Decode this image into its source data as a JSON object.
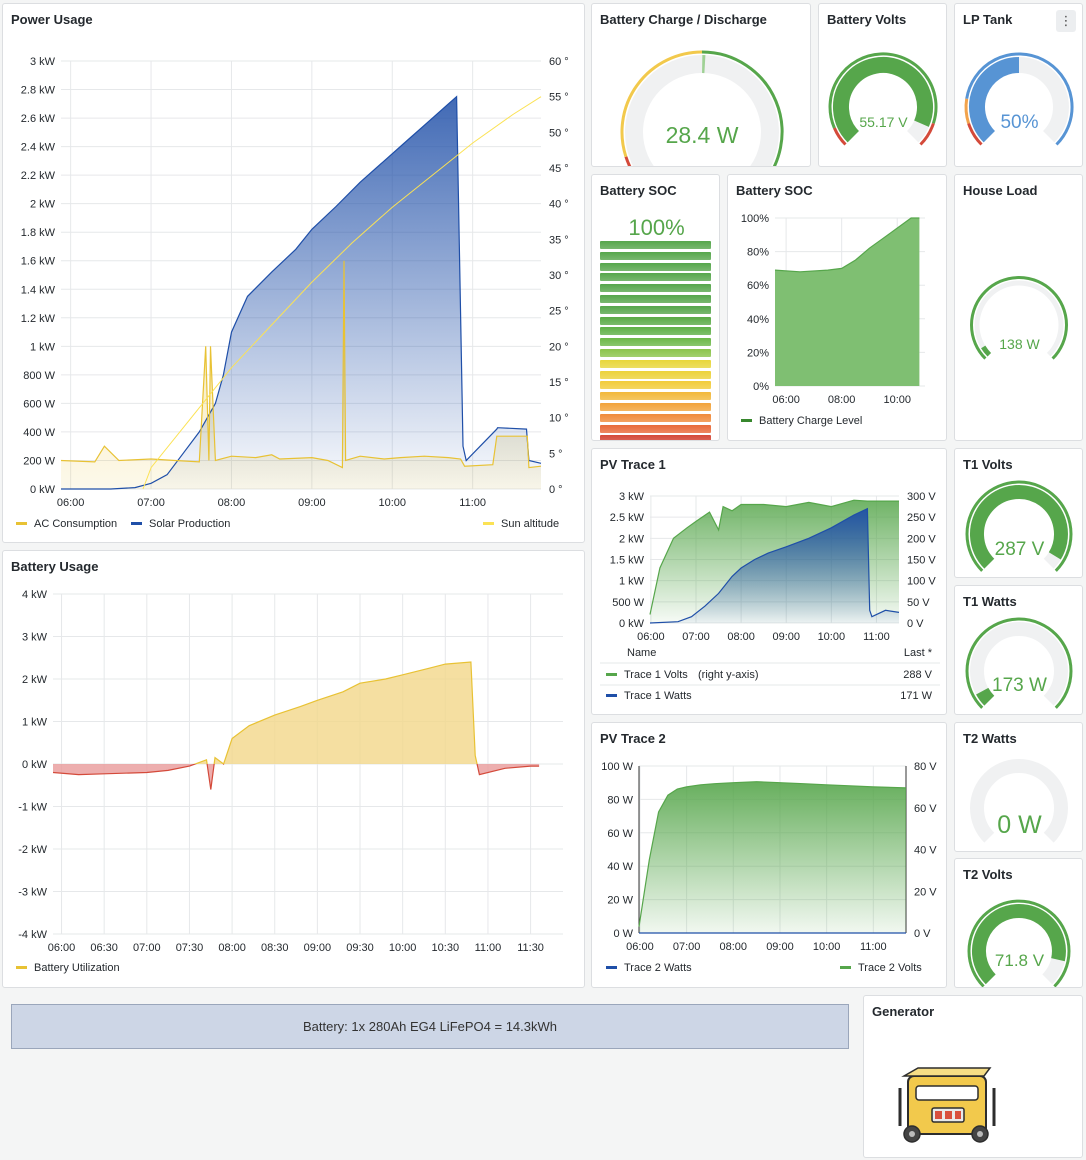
{
  "panels": {
    "power_usage": {
      "title": "Power Usage"
    },
    "battery_charge": {
      "title": "Battery Charge / Discharge",
      "value": "28.4 W"
    },
    "battery_volts": {
      "title": "Battery Volts",
      "value": "55.17 V"
    },
    "lp_tank": {
      "title": "LP Tank",
      "value": "50%",
      "menu_icon": "⋮"
    },
    "battery_soc_bar": {
      "title": "Battery SOC",
      "value": "100%"
    },
    "battery_soc_chart": {
      "title": "Battery SOC"
    },
    "house_load": {
      "title": "House Load",
      "value": "138 W"
    },
    "pv_trace1": {
      "title": "PV Trace 1",
      "legend_header_name": "Name",
      "legend_header_last": "Last *"
    },
    "t1_volts": {
      "title": "T1 Volts",
      "value": "287 V"
    },
    "t1_watts": {
      "title": "T1 Watts",
      "value": "173 W"
    },
    "battery_usage": {
      "title": "Battery Usage"
    },
    "pv_trace2": {
      "title": "PV Trace 2"
    },
    "t2_watts": {
      "title": "T2 Watts",
      "value": "0 W"
    },
    "t2_volts": {
      "title": "T2 Volts",
      "value": "71.8 V"
    },
    "generator": {
      "title": "Generator",
      "icon": "generator-icon"
    }
  },
  "banner": {
    "text": "Battery: 1x 280Ah EG4 LiFePO4 = 14.3kWh"
  },
  "colors": {
    "yellow": "#e8c234",
    "blue": "#1f4fa8",
    "green": "#56a64b",
    "red": "#d44a3a",
    "sun": "#fbe254"
  },
  "chart_data": [
    {
      "id": "power_usage",
      "type": "area",
      "x_ticks": [
        "06:00",
        "07:00",
        "08:00",
        "09:00",
        "10:00",
        "11:00"
      ],
      "y_ticks": [
        "0 kW",
        "200 W",
        "400 W",
        "600 W",
        "800 W",
        "1 kW",
        "1.2 kW",
        "1.4 kW",
        "1.6 kW",
        "1.8 kW",
        "2 kW",
        "2.2 kW",
        "2.4 kW",
        "2.6 kW",
        "2.8 kW",
        "3 kW"
      ],
      "y2_ticks": [
        "0 °",
        "5 °",
        "10 °",
        "15 °",
        "20 °",
        "25 °",
        "30 °",
        "35 °",
        "40 °",
        "45 °",
        "50 °",
        "55 °",
        "60 °"
      ],
      "ylim": [
        0,
        3000
      ],
      "y2lim": [
        0,
        60
      ],
      "series": [
        {
          "name": "AC Consumption",
          "x": [
            5.88,
            6.3,
            6.42,
            6.6,
            7.0,
            7.3,
            7.6,
            7.68,
            7.72,
            7.74,
            7.8,
            8.0,
            8.3,
            8.5,
            8.6,
            9.0,
            9.2,
            9.38,
            9.4,
            9.42,
            9.6,
            9.9,
            10.1,
            10.4,
            10.7,
            10.85,
            10.9,
            11.25,
            11.3,
            11.68,
            11.7,
            11.85
          ],
          "values": [
            200,
            190,
            300,
            200,
            210,
            200,
            190,
            1000,
            200,
            1000,
            200,
            230,
            220,
            240,
            210,
            220,
            200,
            150,
            1600,
            200,
            230,
            210,
            220,
            230,
            220,
            210,
            160,
            170,
            370,
            370,
            150,
            160
          ]
        },
        {
          "name": "Solar Production",
          "x": [
            5.88,
            6.5,
            6.8,
            7.0,
            7.2,
            7.4,
            7.6,
            7.8,
            7.9,
            8.0,
            8.2,
            8.5,
            8.8,
            9.0,
            9.3,
            9.6,
            9.9,
            10.2,
            10.5,
            10.7,
            10.8,
            10.88,
            10.92,
            11.3,
            11.31,
            11.67,
            11.7,
            11.85
          ],
          "values": [
            0,
            0,
            10,
            40,
            100,
            250,
            400,
            600,
            800,
            1100,
            1350,
            1520,
            1680,
            1820,
            1980,
            2150,
            2300,
            2450,
            2600,
            2700,
            2750,
            300,
            200,
            420,
            430,
            420,
            200,
            180
          ]
        },
        {
          "name": "Sun altitude",
          "axis": "right",
          "x": [
            5.88,
            6.5,
            7.0,
            7.5,
            8.0,
            8.5,
            9.0,
            9.5,
            10.0,
            10.5,
            11.0,
            11.5,
            11.85
          ],
          "values": [
            -8,
            -2,
            3,
            10,
            17,
            23,
            29,
            34.5,
            39.5,
            44,
            48.5,
            52.5,
            55
          ]
        }
      ]
    },
    {
      "id": "battery_charge_gauge",
      "type": "gauge",
      "value": 28.4,
      "min": -3000,
      "max": 3000
    },
    {
      "id": "battery_soc_chart",
      "type": "area",
      "x_ticks": [
        "06:00",
        "08:00",
        "10:00"
      ],
      "y_ticks": [
        "0%",
        "20%",
        "40%",
        "60%",
        "80%",
        "100%"
      ],
      "ylim": [
        0,
        100
      ],
      "series": [
        {
          "name": "Battery Charge Level",
          "x": [
            5.6,
            6.5,
            7.5,
            8.0,
            8.5,
            9.0,
            9.5,
            10.0,
            10.5,
            10.8
          ],
          "values": [
            69,
            68,
            69,
            70,
            75,
            82,
            88,
            94,
            100,
            100
          ]
        }
      ]
    },
    {
      "id": "pv_trace1",
      "type": "area",
      "x_ticks": [
        "06:00",
        "07:00",
        "08:00",
        "09:00",
        "10:00",
        "11:00"
      ],
      "y_ticks": [
        "0 kW",
        "500 W",
        "1 kW",
        "1.5 kW",
        "2 kW",
        "2.5 kW",
        "3 kW"
      ],
      "y2_ticks": [
        "0 V",
        "50 V",
        "100 V",
        "150 V",
        "200 V",
        "250 V",
        "300 V"
      ],
      "ylim": [
        0,
        3000
      ],
      "y2lim": [
        0,
        300
      ],
      "series": [
        {
          "name": "Trace 1 Volts",
          "axis_note": "(right y-axis)",
          "last": "288 V",
          "axis": "right",
          "x": [
            5.98,
            6.2,
            6.5,
            6.8,
            7.0,
            7.3,
            7.5,
            7.6,
            7.8,
            8.0,
            8.5,
            9.0,
            9.5,
            10.0,
            10.5,
            10.8,
            11.0,
            11.5
          ],
          "values": [
            20,
            130,
            200,
            225,
            240,
            262,
            220,
            275,
            265,
            280,
            280,
            275,
            285,
            275,
            290,
            288,
            288,
            288
          ]
        },
        {
          "name": "Trace 1 Watts",
          "last": "171 W",
          "x": [
            5.98,
            6.6,
            6.9,
            7.2,
            7.5,
            7.8,
            8.0,
            8.3,
            8.6,
            9.0,
            9.5,
            10.0,
            10.5,
            10.8,
            10.85,
            10.9,
            11.2,
            11.5
          ],
          "values": [
            0,
            30,
            150,
            400,
            700,
            1100,
            1300,
            1500,
            1650,
            1800,
            2000,
            2250,
            2550,
            2700,
            300,
            150,
            300,
            250
          ]
        }
      ]
    },
    {
      "id": "battery_usage",
      "type": "area",
      "x_ticks": [
        "06:00",
        "06:30",
        "07:00",
        "07:30",
        "08:00",
        "08:30",
        "09:00",
        "09:30",
        "10:00",
        "10:30",
        "11:00",
        "11:30"
      ],
      "y_ticks": [
        "-4 kW",
        "-3 kW",
        "-2 kW",
        "-1 kW",
        "0 kW",
        "1 kW",
        "2 kW",
        "3 kW",
        "4 kW"
      ],
      "ylim": [
        -4000,
        4000
      ],
      "series": [
        {
          "name": "Battery Utilization",
          "x": [
            5.9,
            6.2,
            6.5,
            7.0,
            7.25,
            7.5,
            7.7,
            7.75,
            7.8,
            7.9,
            8.0,
            8.2,
            8.5,
            8.8,
            9.0,
            9.3,
            9.5,
            9.8,
            10.0,
            10.3,
            10.5,
            10.8,
            10.85,
            10.9,
            11.2,
            11.5,
            11.6
          ],
          "values": [
            -200,
            -250,
            -230,
            -200,
            -150,
            -50,
            100,
            -600,
            150,
            0,
            600,
            900,
            1150,
            1350,
            1500,
            1700,
            1900,
            2000,
            2100,
            2250,
            2350,
            2400,
            200,
            -250,
            -100,
            -50,
            -50
          ]
        }
      ]
    },
    {
      "id": "pv_trace2",
      "type": "area",
      "x_ticks": [
        "06:00",
        "07:00",
        "08:00",
        "09:00",
        "10:00",
        "11:00"
      ],
      "y_ticks": [
        "0 W",
        "20 W",
        "40 W",
        "60 W",
        "80 W",
        "100 W"
      ],
      "y2_ticks": [
        "0 V",
        "20 V",
        "40 V",
        "60 V",
        "80 V"
      ],
      "ylim": [
        0,
        100
      ],
      "y2lim": [
        0,
        80
      ],
      "series": [
        {
          "name": "Trace 2 Watts",
          "x": [
            5.98,
            11.7
          ],
          "values": [
            0,
            0
          ]
        },
        {
          "name": "Trace 2 Volts",
          "axis": "right",
          "x": [
            5.98,
            6.2,
            6.4,
            6.6,
            6.8,
            7.0,
            7.3,
            7.6,
            8.0,
            8.5,
            9.0,
            9.5,
            10.0,
            10.5,
            11.0,
            11.7
          ],
          "values": [
            3,
            35,
            58,
            66,
            69,
            70,
            71,
            71.5,
            72,
            72.5,
            72,
            71.5,
            71,
            70.5,
            70,
            69.5
          ]
        }
      ]
    }
  ]
}
